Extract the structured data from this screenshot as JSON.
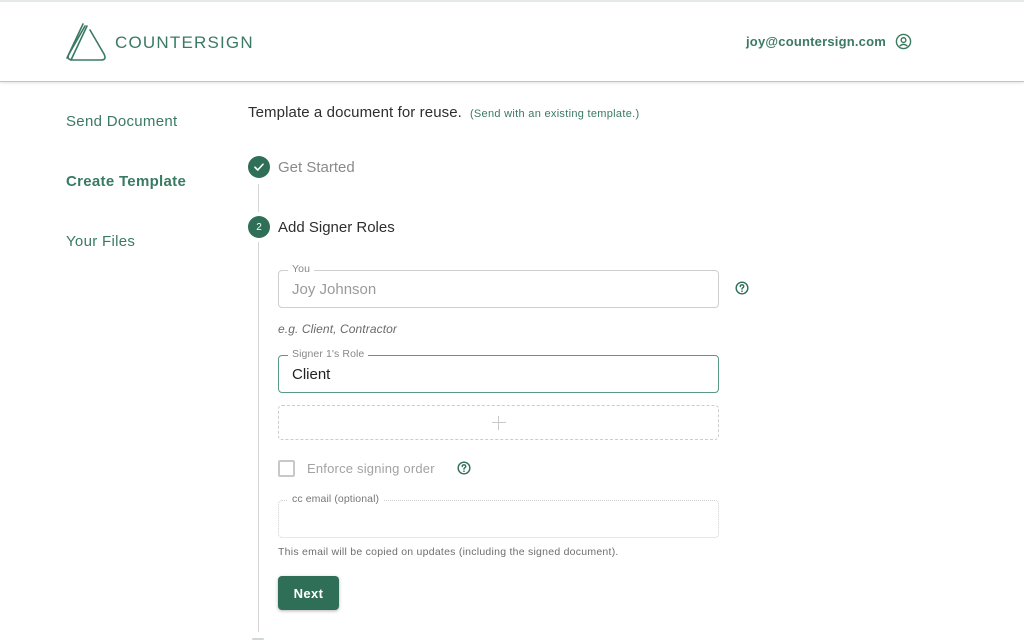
{
  "header": {
    "brand": "COUNTERSIGN",
    "logo_icon": "countersign-logo-icon",
    "user_email": "joy@countersign.com",
    "user_icon": "account-circle-icon"
  },
  "sidebar": {
    "items": [
      {
        "label": "Send Document",
        "active": false
      },
      {
        "label": "Create Template",
        "active": true
      },
      {
        "label": "Your Files",
        "active": false
      }
    ]
  },
  "main": {
    "title": "Template a document for reuse.",
    "alt_link": "(Send with an existing template.)",
    "steps": [
      {
        "number": "1",
        "label": "Get Started",
        "status": "completed",
        "icon": "check-icon"
      },
      {
        "number": "2",
        "label": "Add Signer Roles",
        "status": "active"
      }
    ],
    "form": {
      "you_field": {
        "label": "You",
        "value": "Joy Johnson",
        "help_icon": "help-circle-icon"
      },
      "role_hint": "e.g. Client, Contractor",
      "signer_role_field": {
        "label": "Signer 1's Role",
        "value": "Client"
      },
      "add_role_icon": "plus-icon",
      "enforce_order": {
        "label": "Enforce signing order",
        "checked": false,
        "help_icon": "help-circle-icon"
      },
      "cc_field": {
        "label": "cc email (optional)",
        "value": ""
      },
      "cc_hint": "This email will be copied on updates (including the signed document).",
      "next_label": "Next"
    }
  },
  "colors": {
    "brand": "#3a7a62",
    "primary": "#2f6f57",
    "focused_border": "#5a9a82"
  }
}
